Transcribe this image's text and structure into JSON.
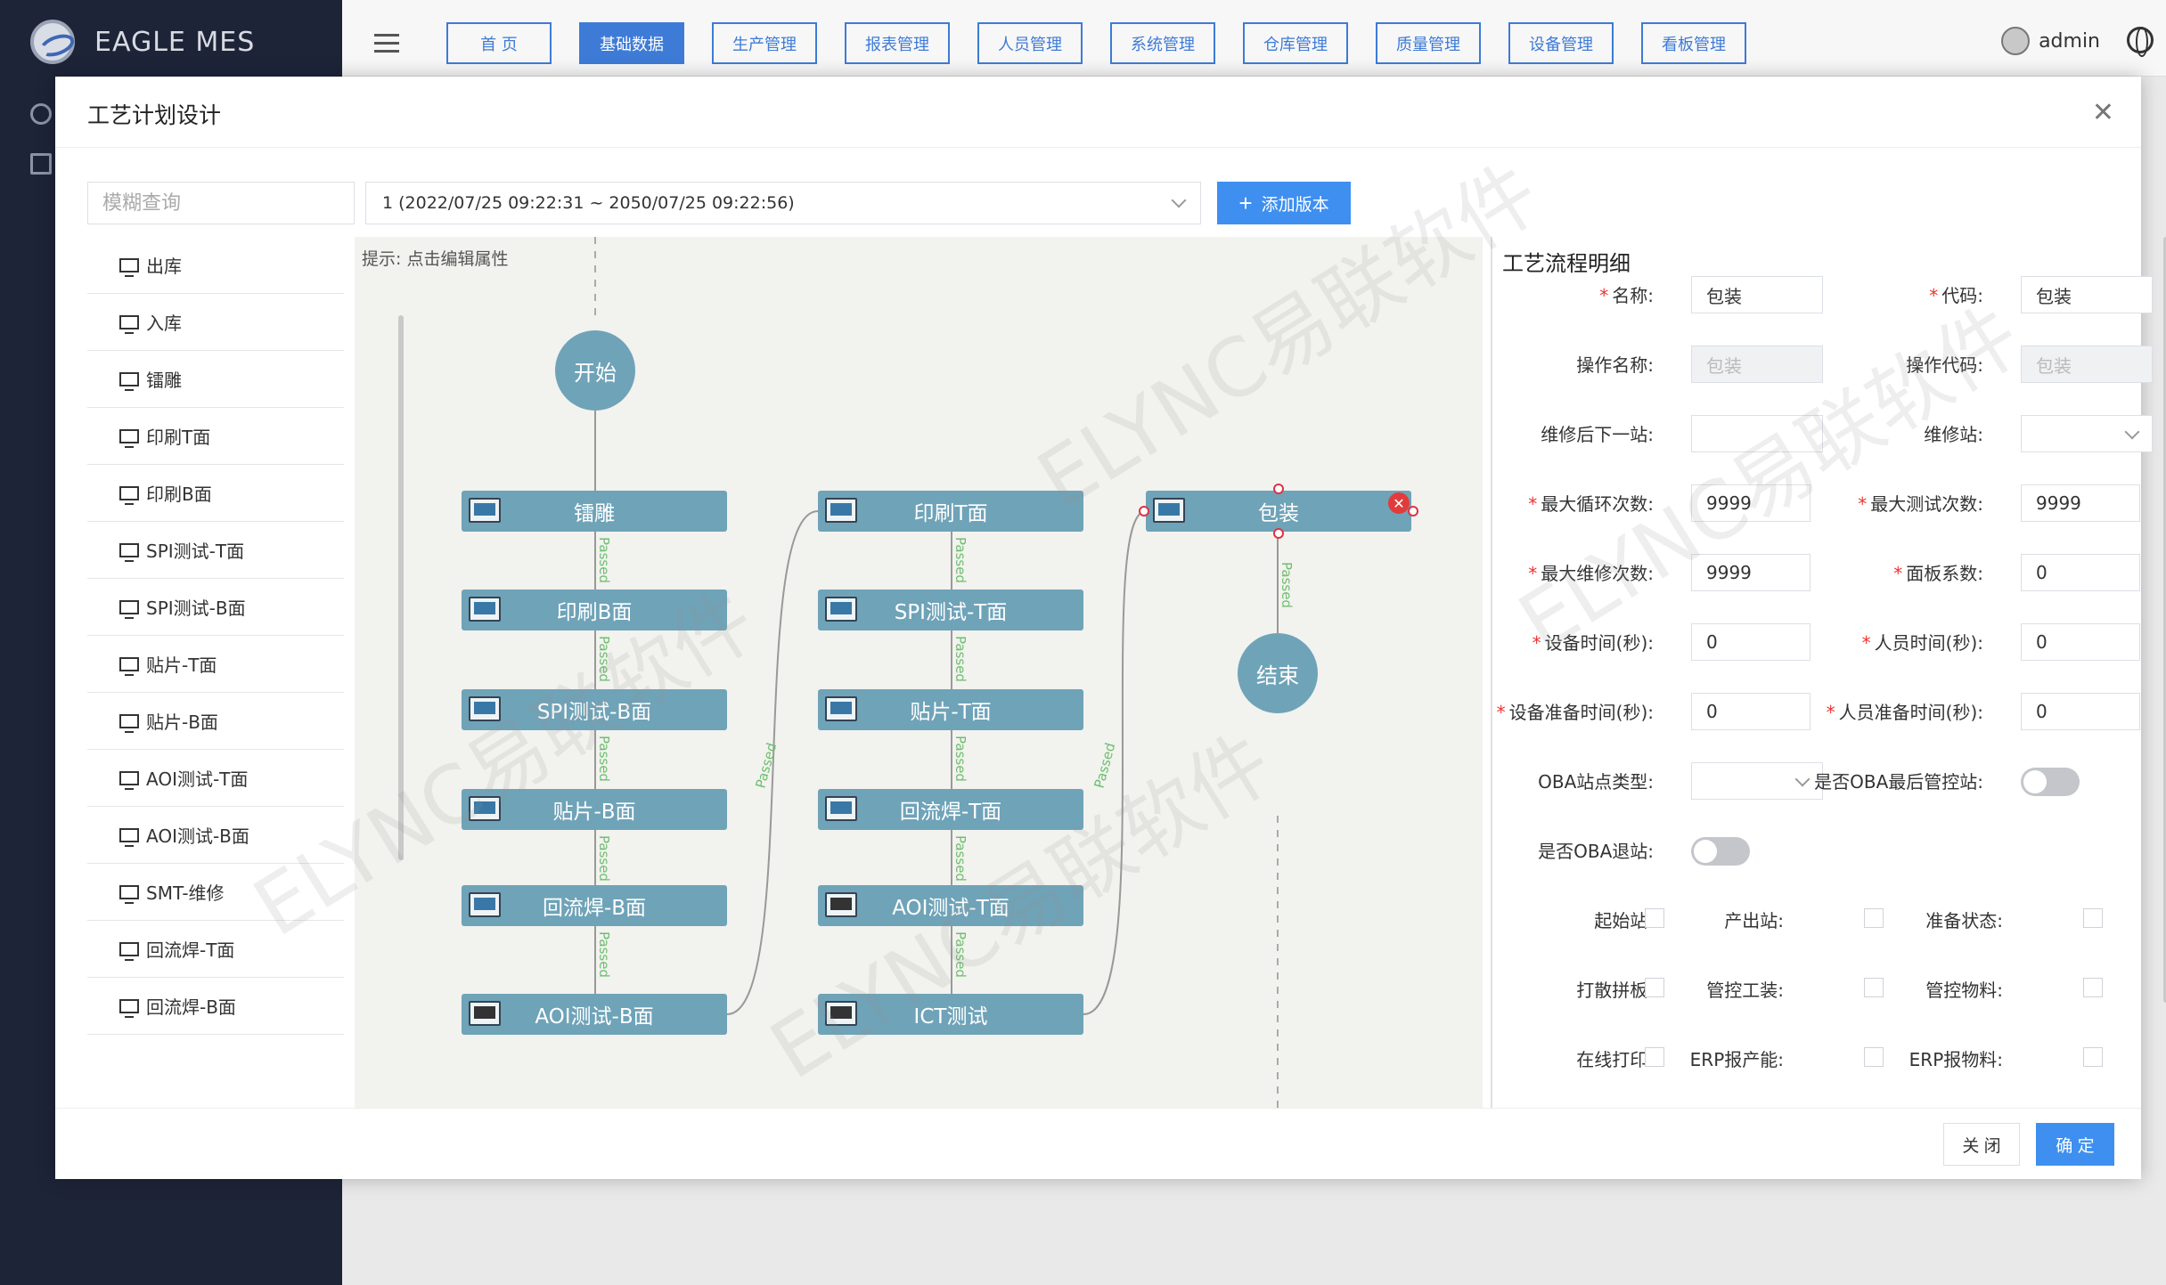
{
  "app": {
    "name": "EAGLE MES"
  },
  "nav": [
    "首 页",
    "基础数据",
    "生产管理",
    "报表管理",
    "人员管理",
    "系统管理",
    "仓库管理",
    "质量管理",
    "设备管理",
    "看板管理"
  ],
  "user": {
    "name": "admin"
  },
  "modal": {
    "title": "工艺计划设计",
    "search_placeholder": "模糊查询",
    "version": "1 (2022/07/25 09:22:31 ~ 2050/07/25 09:22:56)",
    "add_version": "添加版本",
    "canvas_hint": "提示: 点击编辑属性",
    "close_btn": "关 闭",
    "ok_btn": "确 定",
    "watermark": "ELYNC易联软件"
  },
  "stations": [
    "出库",
    "入库",
    "镭雕",
    "印刷T面",
    "印刷B面",
    "SPI测试-T面",
    "SPI测试-B面",
    "贴片-T面",
    "贴片-B面",
    "AOI测试-T面",
    "AOI测试-B面",
    "SMT-维修",
    "回流焊-T面",
    "回流焊-B面"
  ],
  "flow": {
    "start": "开始",
    "end": "结束",
    "edge_label": "Passed",
    "col1": [
      "镭雕",
      "印刷B面",
      "SPI测试-B面",
      "贴片-B面",
      "回流焊-B面",
      "AOI测试-B面"
    ],
    "col2": [
      "印刷T面",
      "SPI测试-T面",
      "贴片-T面",
      "回流焊-T面",
      "AOI测试-T面",
      "ICT测试"
    ],
    "col3": [
      "包装"
    ]
  },
  "detail": {
    "title": "工艺流程明细",
    "name_label": "名称:",
    "name": "包装",
    "code_label": "代码:",
    "code": "包装",
    "op_name_label": "操作名称:",
    "op_name": "包装",
    "op_code_label": "操作代码:",
    "op_code": "包装",
    "repair_next_label": "维修后下一站:",
    "repair_next": "",
    "repair_station_label": "维修站:",
    "max_loop_label": "最大循环次数:",
    "max_loop": "9999",
    "max_test_label": "最大测试次数:",
    "max_test": "9999",
    "max_repair_label": "最大维修次数:",
    "max_repair": "9999",
    "panel_label": "面板系数:",
    "panel": "0",
    "equip_time_label": "设备时间(秒):",
    "equip_time": "0",
    "staff_time_label": "人员时间(秒):",
    "staff_time": "0",
    "equip_prep_label": "设备准备时间(秒):",
    "equip_prep": "0",
    "staff_prep_label": "人员准备时间(秒):",
    "staff_prep": "0",
    "oba_type_label": "OBA站点类型:",
    "oba_last_label": "是否OBA最后管控站:",
    "oba_exit_label": "是否OBA退站:",
    "start_station_label": "起始站:",
    "output_station_label": "产出站:",
    "prep_state_label": "准备状态:",
    "scatter_label": "打散拼板:",
    "ctrl_tool_label": "管控工装:",
    "ctrl_material_label": "管控物料:",
    "online_print_label": "在线打印:",
    "erp_capacity_label": "ERP报产能:",
    "erp_material_label": "ERP报物料:"
  }
}
